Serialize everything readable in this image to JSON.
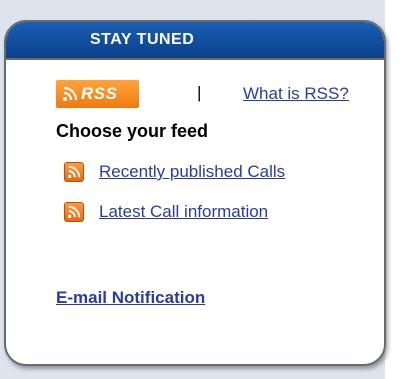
{
  "box": {
    "title": "STAY TUNED"
  },
  "rss": {
    "badge_text": "RSS",
    "separator": "|",
    "what_is_rss": "What is RSS?"
  },
  "feeds": {
    "heading": "Choose your feed",
    "items": [
      {
        "label": "Recently published Calls",
        "icon": "rss-feed-icon"
      },
      {
        "label": "Latest Call information",
        "icon": "rss-feed-icon"
      }
    ]
  },
  "notification": {
    "email_label": "E-mail Notification"
  },
  "colors": {
    "header": "#0b3f8a",
    "link": "#2a3d9e",
    "rss_orange": "#f07a10",
    "panel_bg": "#dce4ed"
  }
}
